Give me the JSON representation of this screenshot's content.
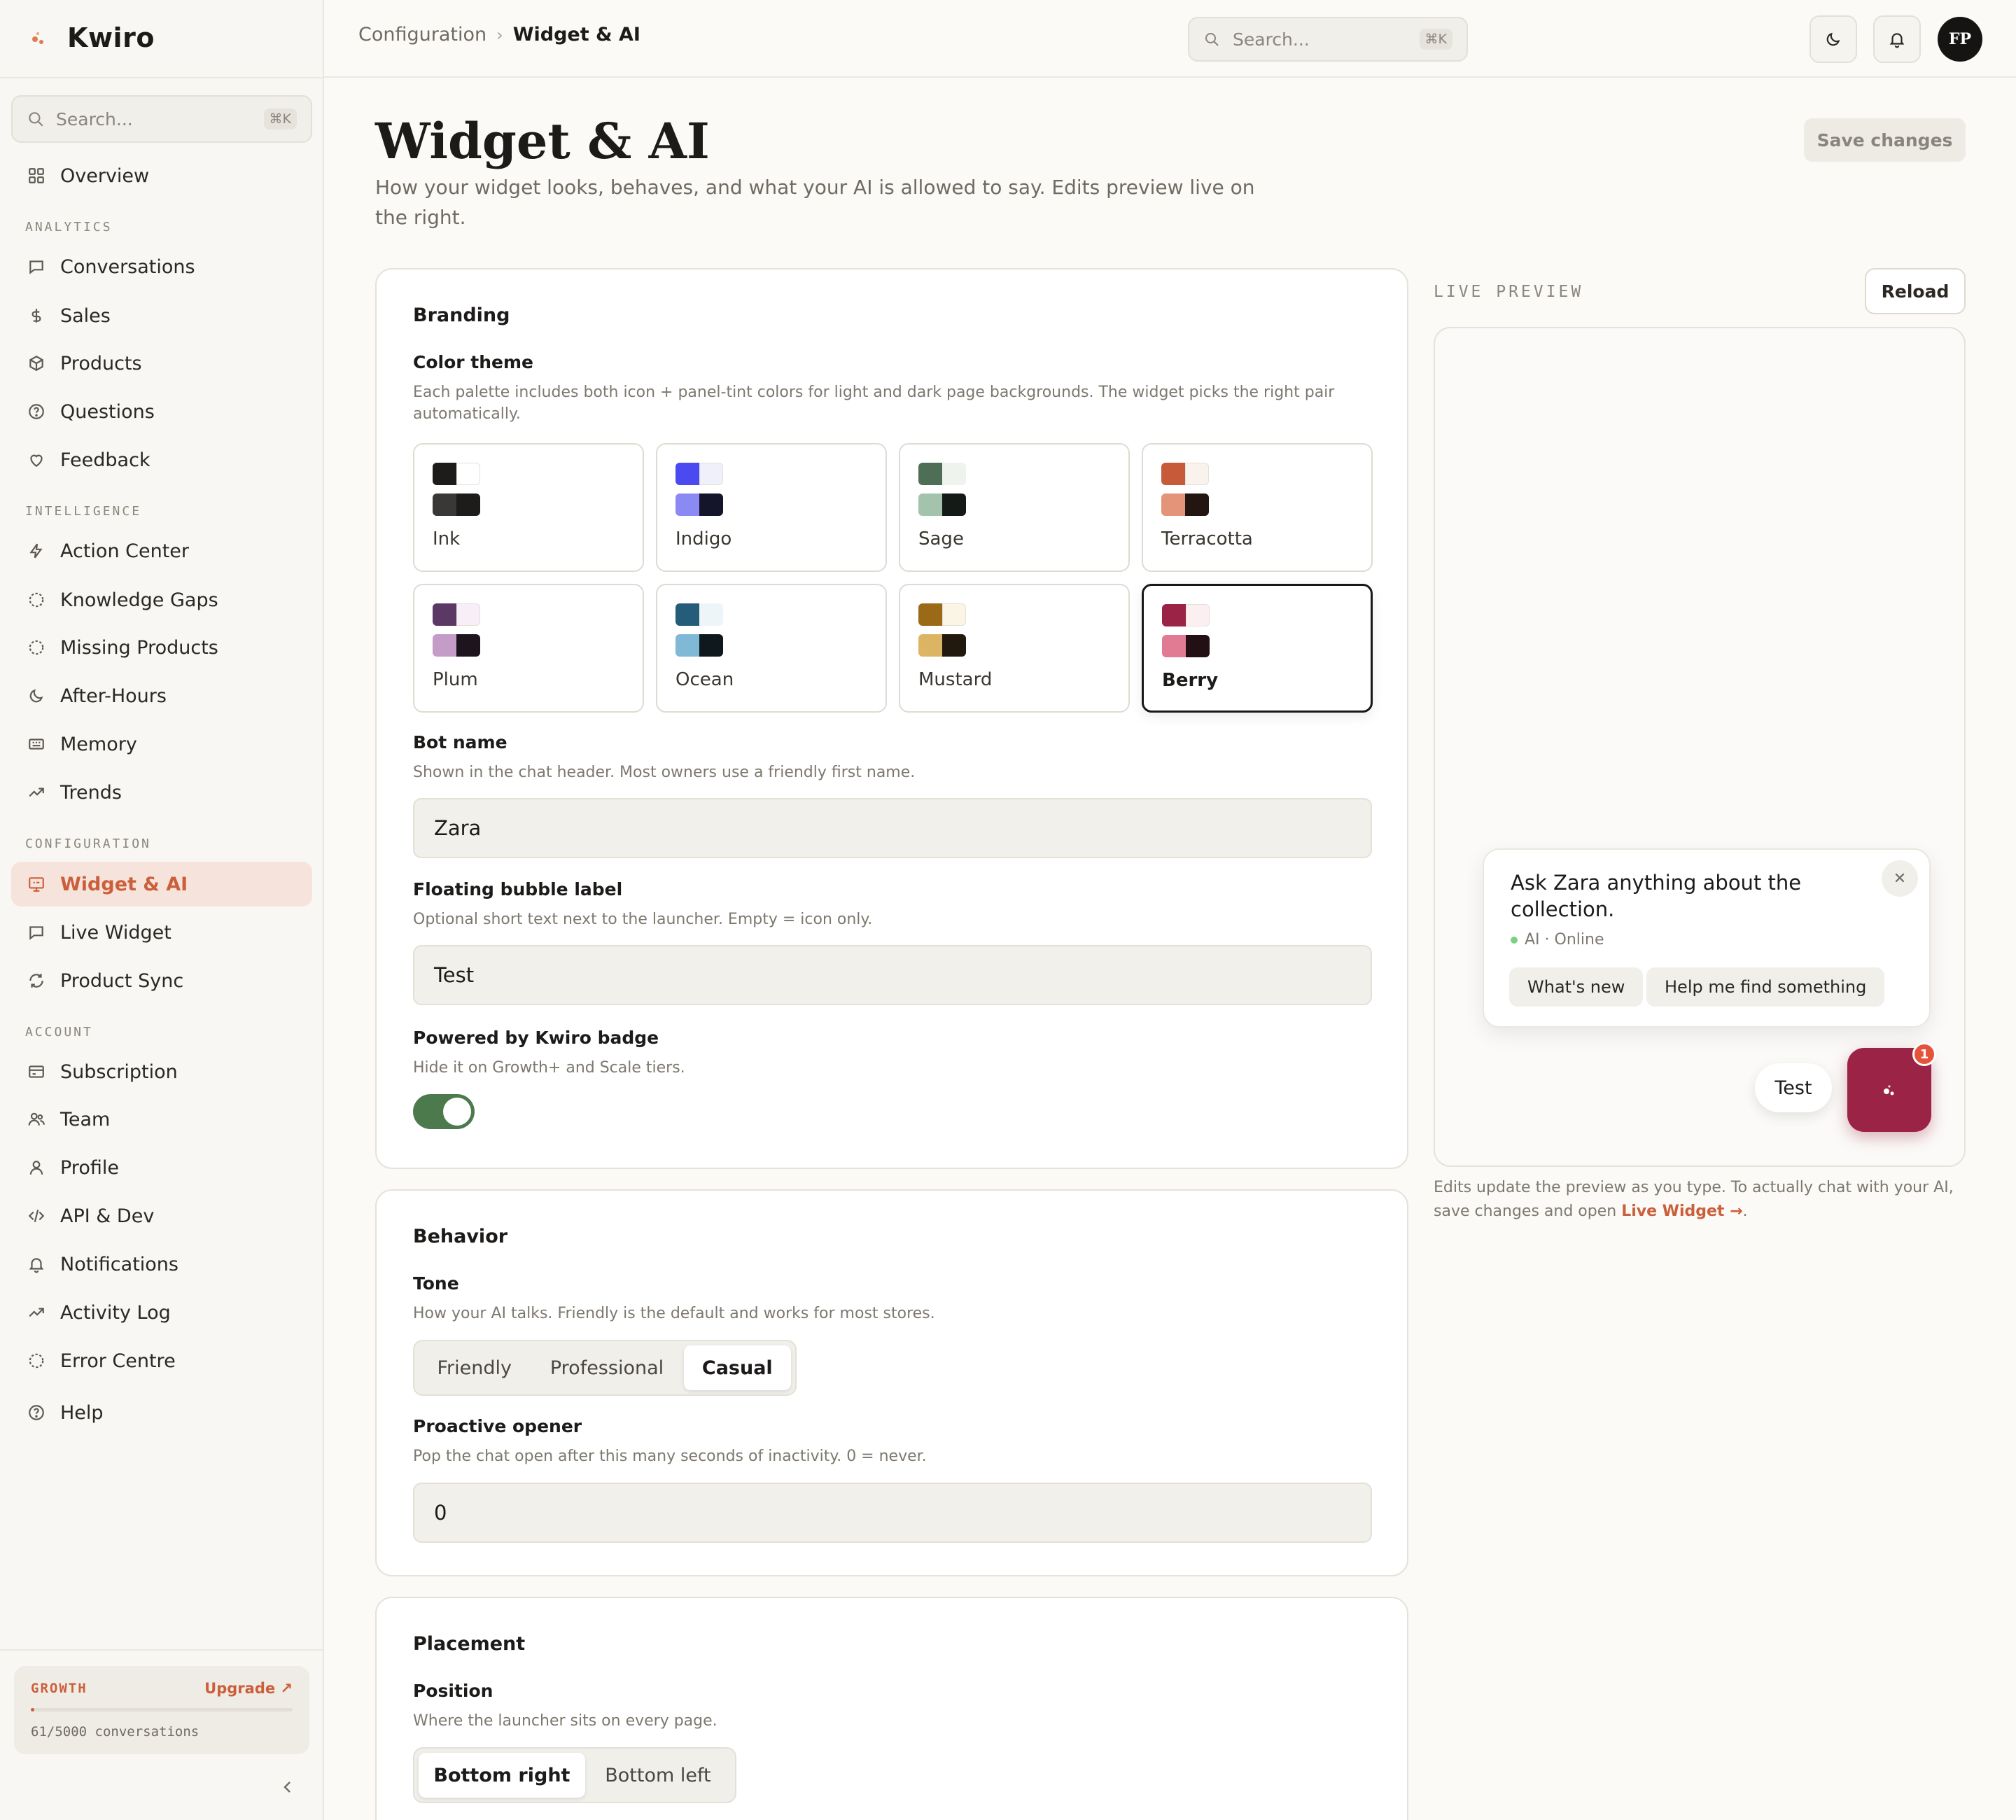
{
  "app": {
    "brand": "Kwiro",
    "accent": "#cc5f3b"
  },
  "sidebar": {
    "search_placeholder": "Search...",
    "search_shortcut": "⌘K",
    "overview": "Overview",
    "sections": {
      "analytics": "ANALYTICS",
      "intelligence": "INTELLIGENCE",
      "configuration": "CONFIGURATION",
      "account": "ACCOUNT"
    },
    "analytics_items": [
      "Conversations",
      "Sales",
      "Products",
      "Questions",
      "Feedback"
    ],
    "intelligence_items": [
      "Action Center",
      "Knowledge Gaps",
      "Missing Products",
      "After-Hours",
      "Memory",
      "Trends"
    ],
    "configuration_items": [
      "Widget & AI",
      "Live Widget",
      "Product Sync"
    ],
    "account_items": [
      "Subscription",
      "Team",
      "Profile",
      "API & Dev",
      "Notifications",
      "Activity Log",
      "Error Centre"
    ],
    "help": "Help",
    "active_item": "Widget & AI",
    "plan": {
      "tier": "GROWTH",
      "upgrade": "Upgrade ↗",
      "usage": "61/5000 conversations",
      "used": 61,
      "limit": 5000
    }
  },
  "topbar": {
    "breadcrumb": [
      "Configuration",
      "Widget & AI"
    ],
    "search_placeholder": "Search...",
    "search_shortcut": "⌘K",
    "avatar_initials": "FP"
  },
  "page": {
    "title": "Widget & AI",
    "subtitle": "How your widget looks, behaves, and what your AI is allowed to say. Edits preview live on the right.",
    "save_button": "Save changes"
  },
  "branding": {
    "title": "Branding",
    "color_theme": {
      "label": "Color theme",
      "hint": "Each palette includes both icon + panel-tint colors for light and dark page backgrounds. The widget picks the right pair automatically.",
      "selected": "Berry",
      "palettes": [
        {
          "name": "Ink",
          "colors": [
            "#1e1c1b",
            "#ffffff",
            "#3a3836",
            "#1e1c1b"
          ]
        },
        {
          "name": "Indigo",
          "colors": [
            "#4b4af0",
            "#f0f0fb",
            "#8b8af4",
            "#14142b"
          ]
        },
        {
          "name": "Sage",
          "colors": [
            "#4e6e55",
            "#eef3ee",
            "#a3c3ad",
            "#141b16"
          ]
        },
        {
          "name": "Terracotta",
          "colors": [
            "#c75b39",
            "#faf2ec",
            "#e39479",
            "#23150f"
          ]
        },
        {
          "name": "Plum",
          "colors": [
            "#5c3964",
            "#f7eef7",
            "#c59bc7",
            "#1d141e"
          ]
        },
        {
          "name": "Ocean",
          "colors": [
            "#245c79",
            "#edf5f9",
            "#80b9d5",
            "#0f181c"
          ]
        },
        {
          "name": "Mustard",
          "colors": [
            "#9a6a17",
            "#fbf5e6",
            "#dbb563",
            "#21190d"
          ]
        },
        {
          "name": "Berry",
          "colors": [
            "#9b2446",
            "#fbeff2",
            "#e07b93",
            "#231015"
          ]
        }
      ]
    },
    "bot_name": {
      "label": "Bot name",
      "hint": "Shown in the chat header. Most owners use a friendly first name.",
      "value": "Zara"
    },
    "bubble_label": {
      "label": "Floating bubble label",
      "hint": "Optional short text next to the launcher. Empty = icon only.",
      "value": "Test"
    },
    "powered_badge": {
      "label": "Powered by Kwiro badge",
      "hint": "Hide it on Growth+ and Scale tiers.",
      "enabled": true
    }
  },
  "behavior": {
    "title": "Behavior",
    "tone": {
      "label": "Tone",
      "hint": "How your AI talks. Friendly is the default and works for most stores.",
      "options": [
        "Friendly",
        "Professional",
        "Casual"
      ],
      "selected": "Casual"
    },
    "proactive": {
      "label": "Proactive opener",
      "hint": "Pop the chat open after this many seconds of inactivity. 0 = never.",
      "value": "0"
    }
  },
  "placement": {
    "title": "Placement",
    "position": {
      "label": "Position",
      "hint": "Where the launcher sits on every page.",
      "options": [
        "Bottom right",
        "Bottom left"
      ],
      "selected": "Bottom right"
    }
  },
  "preview": {
    "label": "LIVE PREVIEW",
    "reload": "Reload",
    "greeting": "Ask Zara anything about the collection.",
    "status": "AI · Online",
    "chips": [
      "What's new",
      "Help me find something"
    ],
    "bubble_text": "Test",
    "badge_count": "1",
    "note_before": "Edits update the preview as you type. To actually chat with your AI, save changes and open ",
    "note_link": "Live Widget →",
    "note_after": "."
  }
}
